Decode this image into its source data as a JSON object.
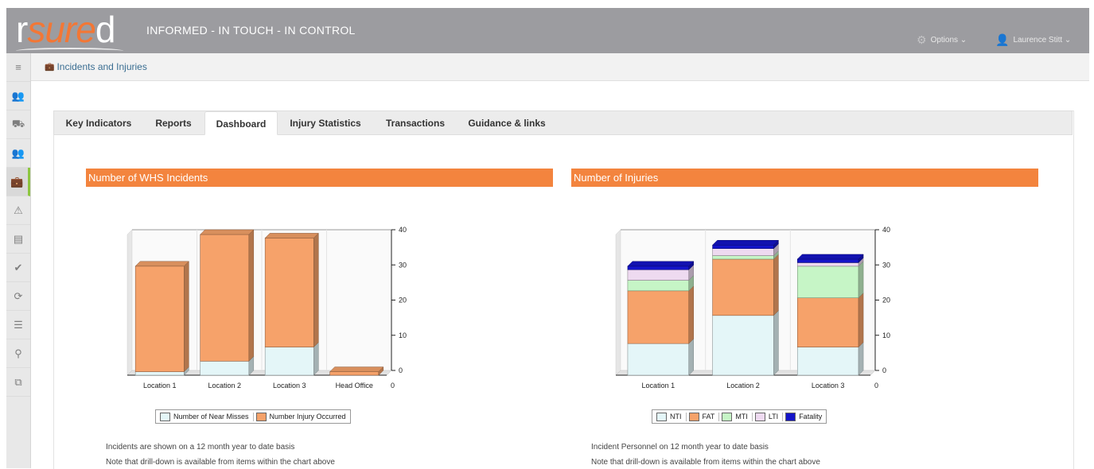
{
  "header": {
    "logo_text": "rsured",
    "logo_prefix": "r",
    "logo_accent": "sure",
    "logo_suffix": "d",
    "logo_tm": "TM",
    "tagline": "INFORMED - IN TOUCH - IN CONTROL",
    "options_label": "Options ⌄",
    "user_label": "Laurence Stitt ⌄"
  },
  "sidebar": {
    "items": [
      {
        "icon": "menu-icon"
      },
      {
        "icon": "people-icon"
      },
      {
        "icon": "truck-icon"
      },
      {
        "icon": "group-icon"
      },
      {
        "icon": "briefcase-icon",
        "active": true
      },
      {
        "icon": "warning-icon"
      },
      {
        "icon": "book-icon"
      },
      {
        "icon": "check-icon"
      },
      {
        "icon": "refresh-icon"
      },
      {
        "icon": "list-icon"
      },
      {
        "icon": "location-icon"
      },
      {
        "icon": "documents-icon"
      }
    ]
  },
  "breadcrumb": {
    "label": "Incidents and Injuries"
  },
  "tabs": [
    {
      "label": "Key Indicators"
    },
    {
      "label": "Reports"
    },
    {
      "label": "Dashboard",
      "active": true
    },
    {
      "label": "Injury Statistics"
    },
    {
      "label": "Transactions"
    },
    {
      "label": "Guidance & links"
    }
  ],
  "left_panel": {
    "title": "Number of WHS Incidents",
    "note1": "Incidents are shown on a 12 month year to date basis",
    "note2": "Note that drill-down is available from items within the chart above"
  },
  "right_panel": {
    "title": "Number of Injuries",
    "note1": "Incident Personnel on 12 month year to date basis",
    "note2": "Note that drill-down is available from items within the chart above"
  },
  "colors": {
    "orange": "#f3843e",
    "near_miss": "#e4f6f8",
    "injury": "#f6a26a",
    "nti": "#e4f6f8",
    "fat": "#f6a26a",
    "mti": "#c6f5c6",
    "lti": "#eedaf0",
    "fatality": "#1414c8"
  },
  "chart_data": [
    {
      "type": "bar",
      "stacked": true,
      "categories": [
        "Location 1",
        "Location 2",
        "Location 3",
        "Head Office"
      ],
      "series": [
        {
          "name": "Number of Near Misses",
          "values": [
            1,
            4,
            8,
            0
          ]
        },
        {
          "name": "Number Injury Occurred",
          "values": [
            30,
            36,
            31,
            1
          ]
        }
      ],
      "ylim": [
        0,
        40
      ],
      "yticks": [
        0,
        10,
        20,
        30,
        40
      ],
      "y_axis_side": "right",
      "legend_position": "bottom"
    },
    {
      "type": "bar",
      "stacked": true,
      "categories": [
        "Location 1",
        "Location 2",
        "Location 3"
      ],
      "series": [
        {
          "name": "NTI",
          "values": [
            9,
            17,
            8
          ]
        },
        {
          "name": "FAT",
          "values": [
            15,
            16,
            14
          ]
        },
        {
          "name": "MTI",
          "values": [
            3,
            1,
            9
          ]
        },
        {
          "name": "LTI",
          "values": [
            3,
            2,
            1
          ]
        },
        {
          "name": "Fatality",
          "values": [
            1,
            1,
            1
          ]
        }
      ],
      "ylim": [
        0,
        40
      ],
      "yticks": [
        0,
        10,
        20,
        30,
        40
      ],
      "y_axis_side": "right",
      "legend_position": "bottom"
    }
  ]
}
